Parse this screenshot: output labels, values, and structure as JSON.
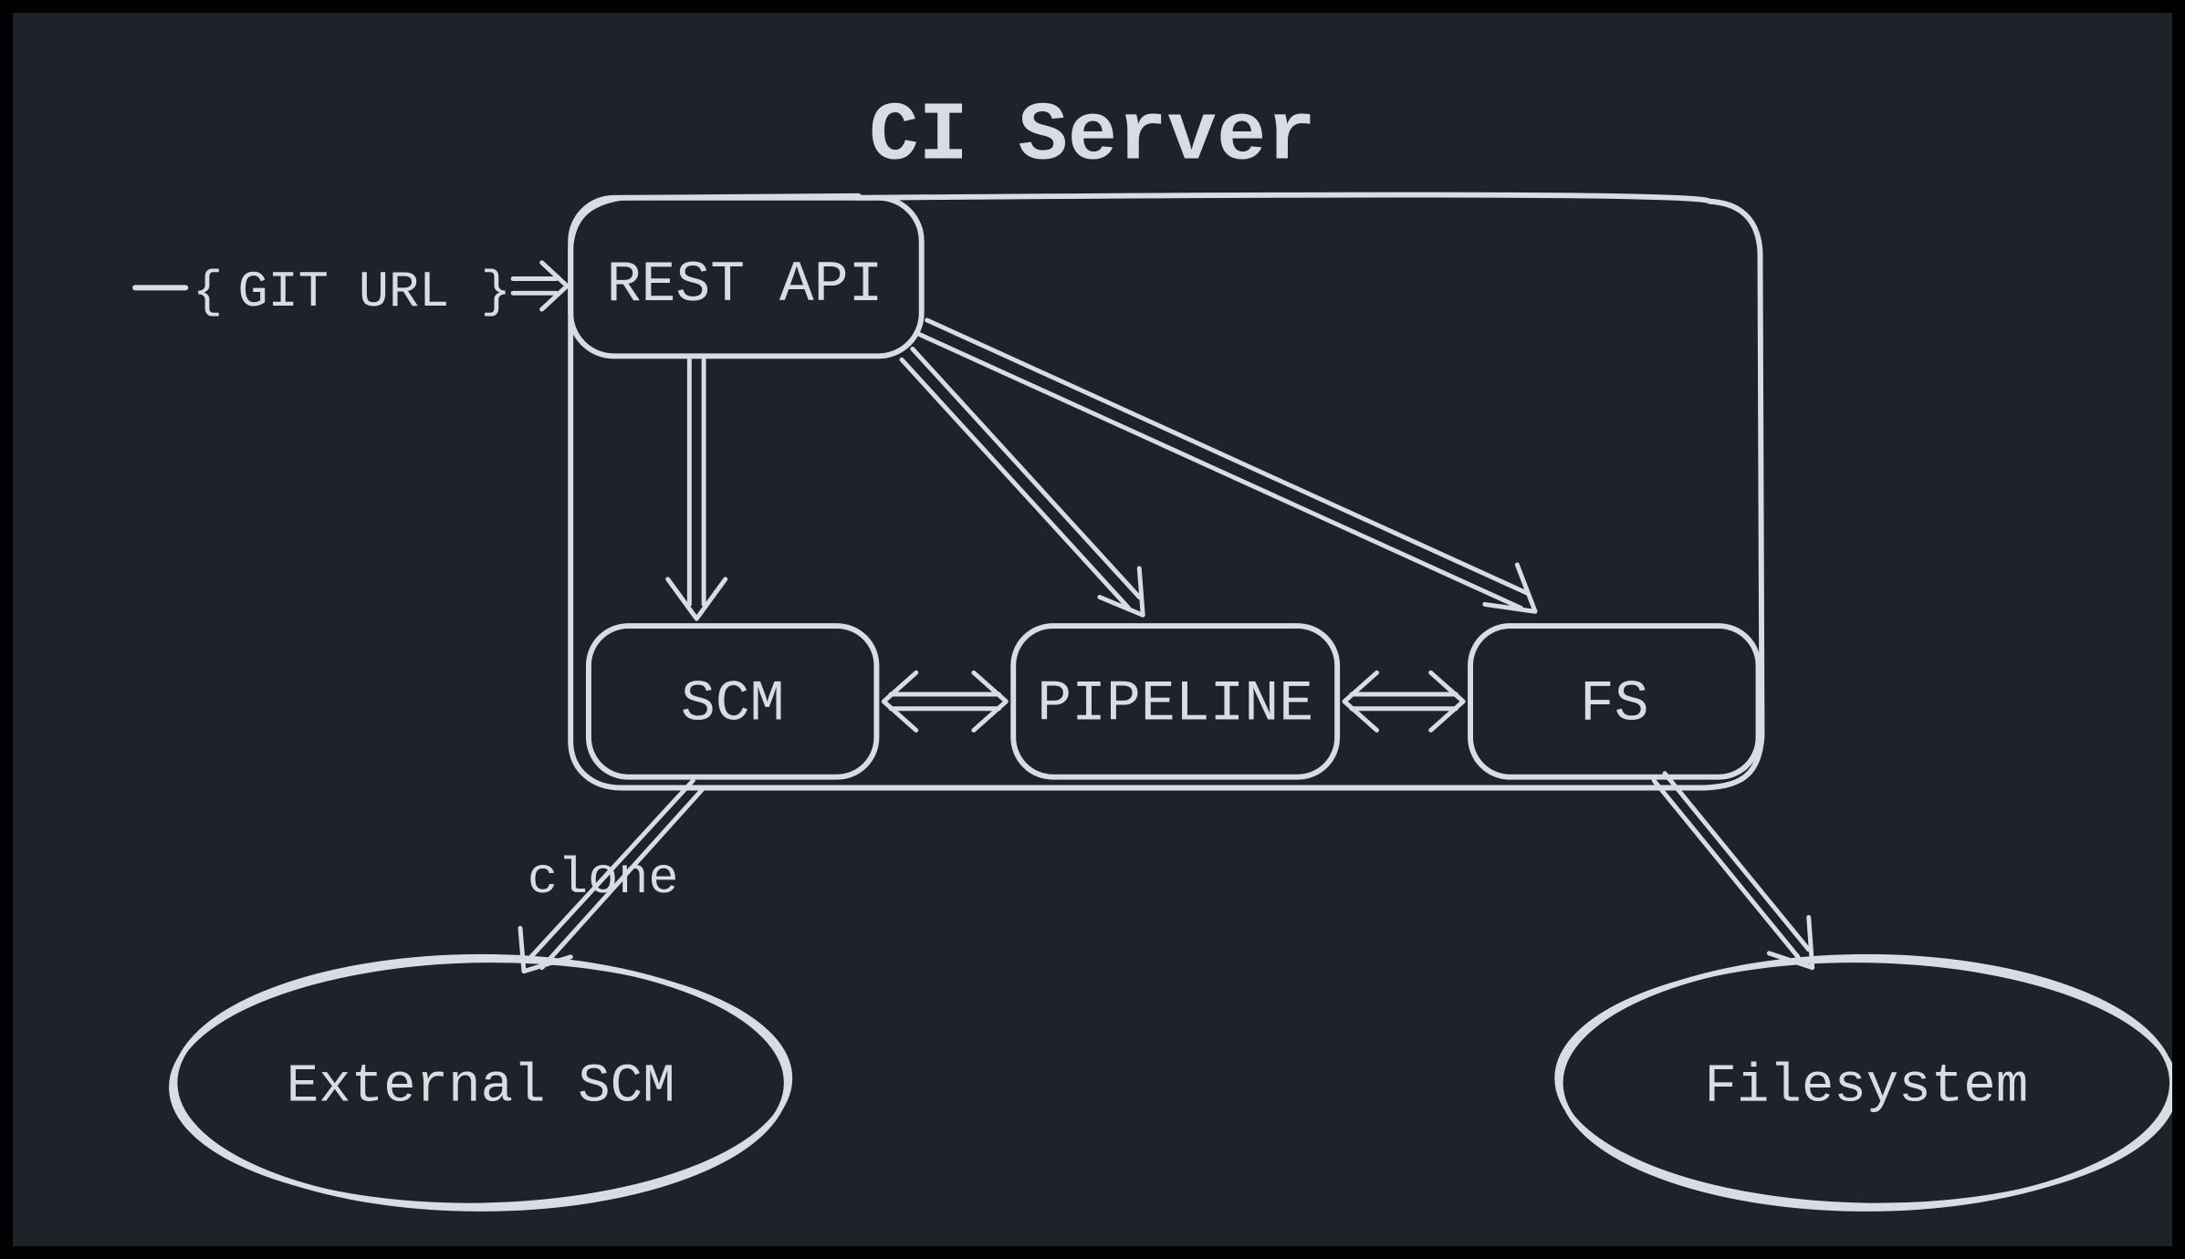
{
  "diagram": {
    "title": "CI Server",
    "input_label": "GIT URL",
    "nodes": {
      "rest_api": "REST API",
      "scm": "SCM",
      "pipeline": "PIPELINE",
      "fs": "FS"
    },
    "external": {
      "scm": "External SCM",
      "filesystem": "Filesystem"
    },
    "edge_labels": {
      "scm_to_external": "clone"
    }
  }
}
